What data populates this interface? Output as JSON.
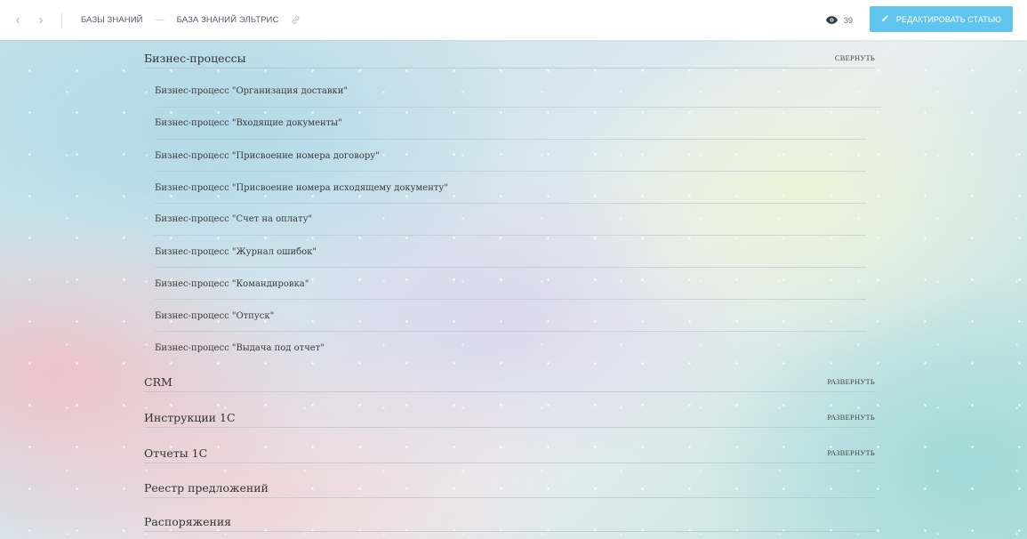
{
  "header": {
    "breadcrumbs": [
      "БАЗЫ ЗНАНИЙ",
      "БАЗА ЗНАНИЙ ЭЛЬТРИС"
    ],
    "crumb_separator": "—",
    "views_count": "39",
    "edit_button_label": "РЕДАКТИРОВАТЬ СТАТЬЮ",
    "accent_color": "#5fc4ee"
  },
  "sections": [
    {
      "title": "Бизнес-процессы",
      "toggle": "СВЕРНУТЬ",
      "items": [
        "Бизнес-процесс \"Организация доставки\"",
        "Бизнес-процесс \"Входящие документы\"",
        "Бизнес-процесс \"Присвоение номера договору\"",
        "Бизнес-процесс \"Присвоение номера исходящему документу\"",
        "Бизнес-процесс \"Счет на оплату\"",
        "Бизнес-процесс \"Журнал ошибок\"",
        "Бизнес-процесс \"Командировка\"",
        "Бизнес-процесс \"Отпуск\"",
        "Бизнес-процесс \"Выдача под отчет\""
      ]
    },
    {
      "title": "CRM",
      "toggle": "РАЗВЕРНУТЬ"
    },
    {
      "title": "Инструкции 1С",
      "toggle": "РАЗВЕРНУТЬ"
    },
    {
      "title": "Отчеты 1С",
      "toggle": "РАЗВЕРНУТЬ"
    },
    {
      "title": "Реестр предложений"
    },
    {
      "title": "Распоряжения"
    }
  ]
}
